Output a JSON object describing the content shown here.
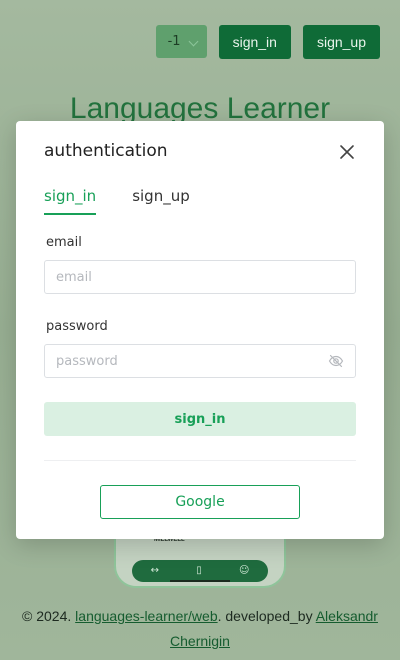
{
  "header": {
    "language_value": "-1",
    "sign_in_label": "sign_in",
    "sign_up_label": "sign_up"
  },
  "app_title": "Languages Learner",
  "phone_preview": {
    "label": "MILLWELL"
  },
  "modal": {
    "title": "authentication",
    "tabs": [
      {
        "label": "sign_in",
        "active": true
      },
      {
        "label": "sign_up",
        "active": false
      }
    ],
    "email": {
      "label": "email",
      "placeholder": "email",
      "value": ""
    },
    "password": {
      "label": "password",
      "placeholder": "password",
      "value": ""
    },
    "submit_label": "sign_in",
    "google_label": "Google"
  },
  "footer": {
    "prefix": "© 2024. ",
    "repo_link": "languages-learner/web",
    "middle": ". developed_by ",
    "author_link": "Aleksandr Chernigin"
  },
  "colors": {
    "accent": "#18a058",
    "header_button": "#0f6b37",
    "submit_bg": "#daf0e2"
  },
  "icons": [
    "close-icon",
    "eye-off-icon",
    "chevron-down-icon",
    "dumbbell-icon",
    "book-icon",
    "user-icon"
  ]
}
